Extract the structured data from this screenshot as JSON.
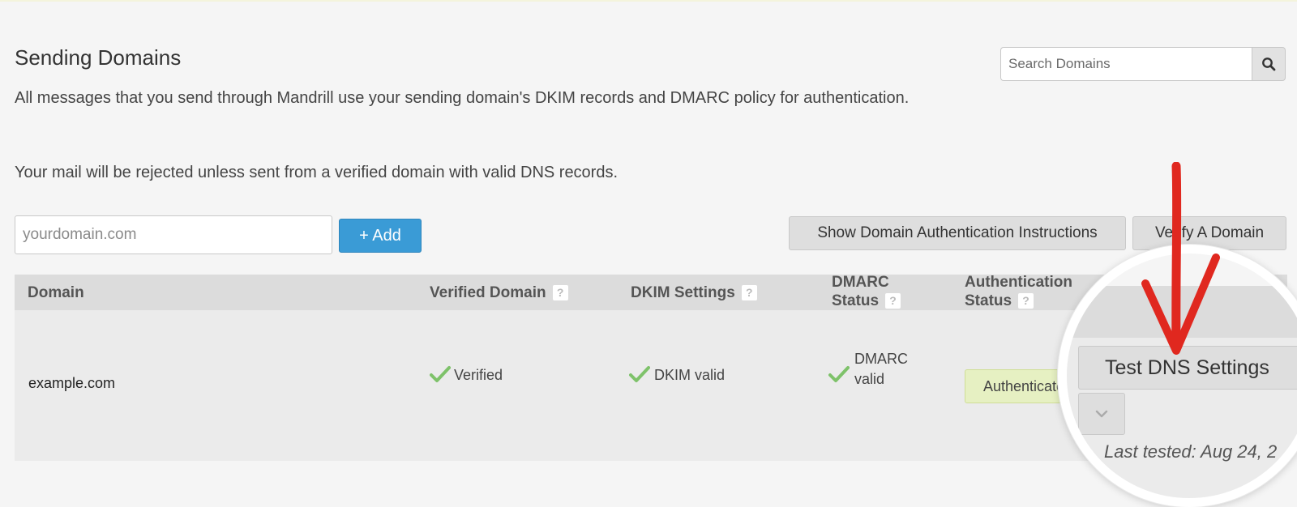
{
  "page": {
    "title": "Sending Domains",
    "description": "All messages that you send through Mandrill use your sending domain's DKIM records and DMARC policy for authentication.",
    "warning": "Your mail will be rejected unless sent from a verified domain with valid DNS records."
  },
  "search": {
    "placeholder": "Search Domains",
    "icon": "search-icon"
  },
  "add_form": {
    "input_placeholder": "yourdomain.com",
    "add_label": "+ Add"
  },
  "actions": {
    "show_instructions_label": "Show Domain Authentication Instructions",
    "verify_domain_label": "Verify A Domain"
  },
  "table": {
    "headers": {
      "domain": "Domain",
      "verified": "Verified Domain",
      "dkim": "DKIM Settings",
      "dmarc_line1": "DMARC",
      "dmarc_line2": "Status",
      "auth_line1": "Authentication",
      "auth_line2": "Status",
      "help": "?"
    },
    "rows": [
      {
        "domain": "example.com",
        "verified": "Verified",
        "dkim": "DKIM valid",
        "dmarc_line1": "DMARC",
        "dmarc_line2": "valid",
        "auth": "Authenticated",
        "test_dns_label": "Test DNS Settings",
        "last_tested": "Last tested: Aug 24, 2"
      }
    ]
  },
  "colors": {
    "accent_blue": "#3a9bd6",
    "check_green": "#7ec26a",
    "badge_green": "#e6f0c2",
    "annotation_red": "#e0281f"
  }
}
